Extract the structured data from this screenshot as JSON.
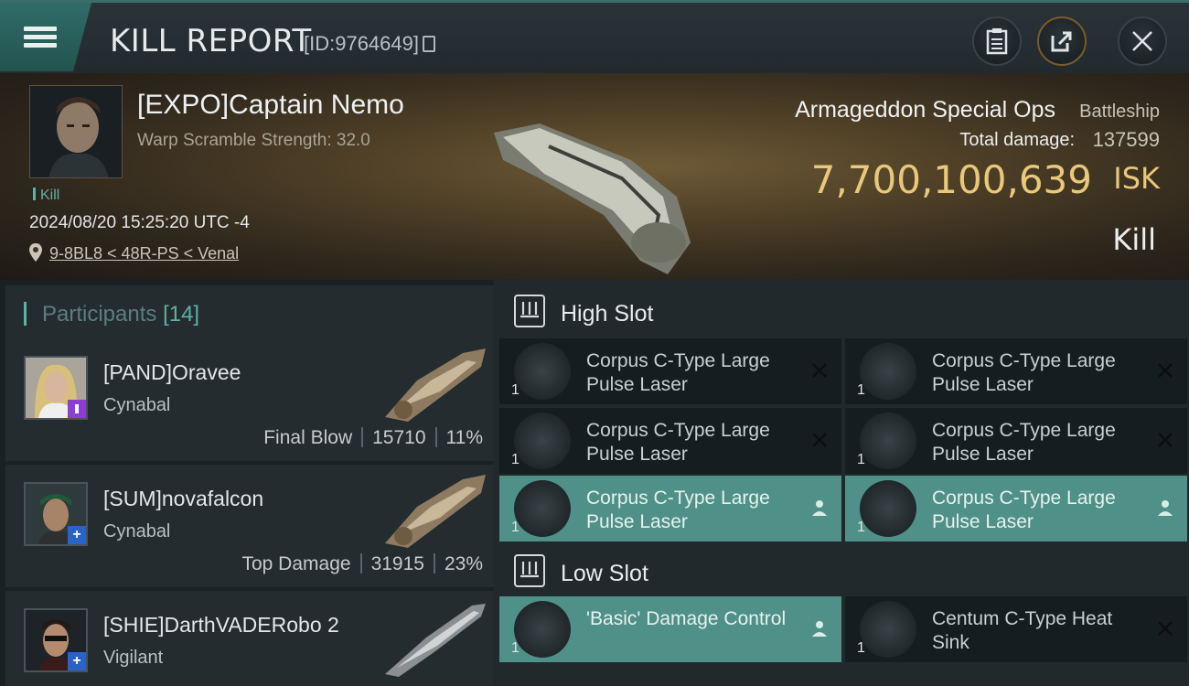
{
  "header": {
    "title": "KILL REPORT",
    "kill_id": "[ID:9764649]"
  },
  "victim": {
    "name": "[EXPO]Captain Nemo",
    "warp_scramble": "Warp Scramble Strength: 32.0",
    "tag": "Kill",
    "datetime": "2024/08/20 15:25:20 UTC -4",
    "location": "9-8BL8 < 48R-PS < Venal",
    "ship_name": "Armageddon Special Ops",
    "ship_class": "Battleship",
    "total_damage_label": "Total damage:",
    "total_damage": "137599",
    "isk_value": "7,700,100,639",
    "isk_unit": "ISK",
    "result": "Kill"
  },
  "participants": {
    "title": "Participants",
    "count": "[14]",
    "rows": [
      {
        "name": "[PAND]Oravee",
        "ship": "Cynabal",
        "role": "Final Blow",
        "damage": "15710",
        "percent": "11%",
        "badge_color": "#8a3fd1",
        "badge_icon": "gem-icon"
      },
      {
        "name": "[SUM]novafalcon",
        "ship": "Cynabal",
        "role": "Top Damage",
        "damage": "31915",
        "percent": "23%",
        "badge_color": "#2a63c8",
        "badge_icon": "plus-icon"
      },
      {
        "name": "[SHIE]DarthVADERobo 2",
        "ship": "Vigilant",
        "role": "",
        "damage": "",
        "percent": "",
        "badge_color": "#2a63c8",
        "badge_icon": "plus-icon"
      }
    ]
  },
  "slots": {
    "high": {
      "label": "High Slot",
      "modules": [
        {
          "name": "Corpus C-Type Large Pulse Laser",
          "qty": "1",
          "state": "destroyed"
        },
        {
          "name": "Corpus C-Type Large Pulse Laser",
          "qty": "1",
          "state": "destroyed"
        },
        {
          "name": "Corpus C-Type Large Pulse Laser",
          "qty": "1",
          "state": "destroyed"
        },
        {
          "name": "Corpus C-Type Large Pulse Laser",
          "qty": "1",
          "state": "destroyed"
        },
        {
          "name": "Corpus C-Type Large Pulse Laser",
          "qty": "1",
          "state": "dropped"
        },
        {
          "name": "Corpus C-Type Large Pulse Laser",
          "qty": "1",
          "state": "dropped"
        }
      ]
    },
    "low": {
      "label": "Low Slot",
      "modules": [
        {
          "name": "'Basic' Damage Control",
          "qty": "1",
          "state": "dropped"
        },
        {
          "name": "Centum C-Type Heat Sink",
          "qty": "1",
          "state": "destroyed"
        }
      ]
    }
  },
  "colors": {
    "accent": "#5fb0a6",
    "isk": "#e8c87b",
    "dropped_bg": "#4f9088"
  }
}
